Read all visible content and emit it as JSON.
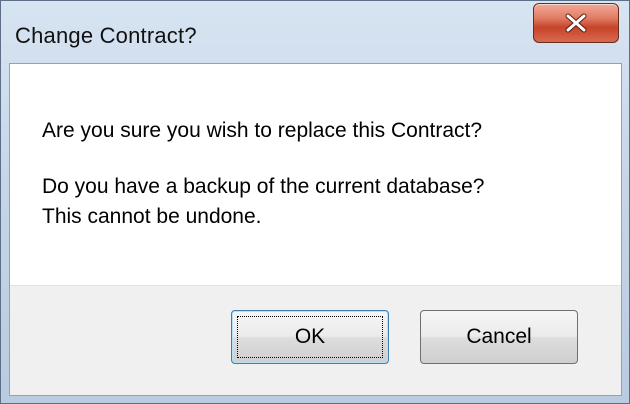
{
  "window": {
    "title": "Change Contract?",
    "close_icon": "close-icon"
  },
  "message": {
    "line1": "Are you sure you wish to replace this Contract?",
    "line2": "Do you have a backup of the current database?",
    "line3": "This cannot be undone."
  },
  "buttons": {
    "ok_label": "OK",
    "cancel_label": "Cancel"
  },
  "colors": {
    "titlebar": "#c6d6e8",
    "close_button": "#c6442a",
    "footer": "#f0f0f0"
  }
}
